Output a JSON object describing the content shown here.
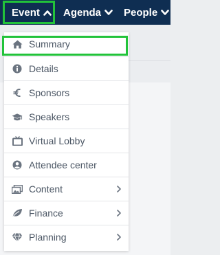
{
  "nav": {
    "items": [
      {
        "label": "Event",
        "icon": "chevron-up-icon"
      },
      {
        "label": "Agenda",
        "icon": "chevron-down-icon"
      },
      {
        "label": "People",
        "icon": "chevron-down-icon"
      }
    ]
  },
  "menu": {
    "items": [
      {
        "label": "Summary",
        "icon": "home-icon",
        "submenu": false
      },
      {
        "label": "Details",
        "icon": "info-icon",
        "submenu": false
      },
      {
        "label": "Sponsors",
        "icon": "euro-icon",
        "submenu": false
      },
      {
        "label": "Speakers",
        "icon": "graduation-cap-icon",
        "submenu": false
      },
      {
        "label": "Virtual Lobby",
        "icon": "tv-icon",
        "submenu": false
      },
      {
        "label": "Attendee center",
        "icon": "user-circle-icon",
        "submenu": false
      },
      {
        "label": "Content",
        "icon": "images-icon",
        "submenu": true
      },
      {
        "label": "Finance",
        "icon": "leaf-icon",
        "submenu": true
      },
      {
        "label": "Planning",
        "icon": "diamond-icon",
        "submenu": true
      }
    ]
  },
  "colors": {
    "topbar": "#0f2e52",
    "highlight": "#22c33a",
    "menu_text": "#4a5563",
    "menu_icon": "#6b7480"
  }
}
